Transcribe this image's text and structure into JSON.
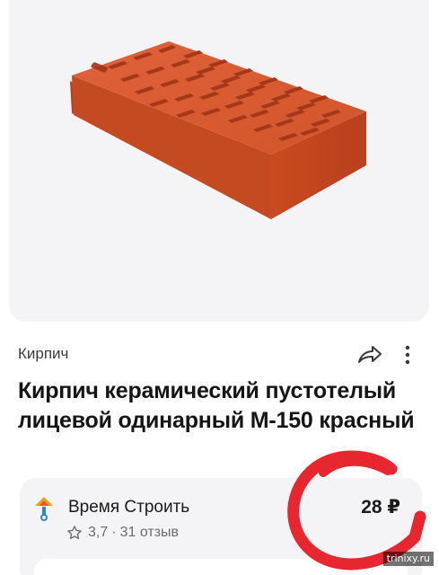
{
  "product": {
    "category": "Кирпич",
    "title": "Кирпич керамический пустотелый лицевой одинарный М-150 красный",
    "image_icon": "brick-image"
  },
  "actions": {
    "share_icon": "share-icon",
    "more_icon": "more-vertical-icon"
  },
  "seller": {
    "name": "Время Строить",
    "price": "28 ₽",
    "rating": "3,7",
    "reviews": "31 отзыв",
    "separator": "·",
    "logo_icon": "seller-logo-icon",
    "star_icon": "star-outline-icon"
  },
  "annotation": {
    "color": "#e8262f"
  },
  "watermark": "trinixy.ru",
  "colors": {
    "background": "#ffffff",
    "card": "#f4f4f6",
    "brick": "#d2542a",
    "text": "#151515",
    "muted": "#6b6b6b"
  }
}
